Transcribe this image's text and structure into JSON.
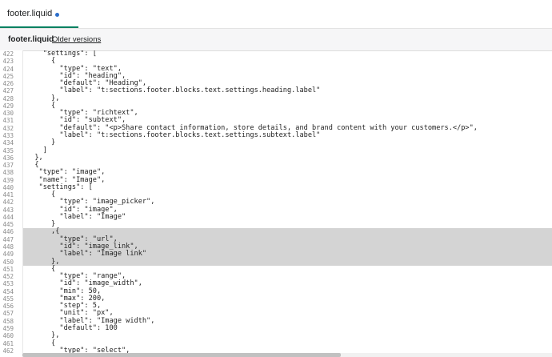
{
  "tab": {
    "label": "footer.liquid"
  },
  "file_header": {
    "name": "footer.liquid",
    "older_versions": "Older versions"
  },
  "editor": {
    "highlighted_lines": [
      446,
      447,
      448,
      449,
      450
    ],
    "lines": [
      {
        "n": "422",
        "text": "    \"settings\": ["
      },
      {
        "n": "423",
        "text": "      {"
      },
      {
        "n": "424",
        "text": "        \"type\": \"text\","
      },
      {
        "n": "425",
        "text": "        \"id\": \"heading\","
      },
      {
        "n": "426",
        "text": "        \"default\": \"Heading\","
      },
      {
        "n": "427",
        "text": "        \"label\": \"t:sections.footer.blocks.text.settings.heading.label\""
      },
      {
        "n": "428",
        "text": "      },"
      },
      {
        "n": "429",
        "text": "      {"
      },
      {
        "n": "430",
        "text": "        \"type\": \"richtext\","
      },
      {
        "n": "431",
        "text": "        \"id\": \"subtext\","
      },
      {
        "n": "432",
        "text": "        \"default\": \"<p>Share contact information, store details, and brand content with your customers.</p>\","
      },
      {
        "n": "433",
        "text": "        \"label\": \"t:sections.footer.blocks.text.settings.subtext.label\""
      },
      {
        "n": "434",
        "text": "      }"
      },
      {
        "n": "435",
        "text": "    ]"
      },
      {
        "n": "436",
        "text": "  },"
      },
      {
        "n": "437",
        "text": "  {"
      },
      {
        "n": "438",
        "text": "   \"type\": \"image\","
      },
      {
        "n": "439",
        "text": "   \"name\": \"Image\","
      },
      {
        "n": "440",
        "text": "   \"settings\": ["
      },
      {
        "n": "441",
        "text": "      {"
      },
      {
        "n": "442",
        "text": "        \"type\": \"image_picker\","
      },
      {
        "n": "443",
        "text": "        \"id\": \"image\","
      },
      {
        "n": "444",
        "text": "        \"label\": \"Image\""
      },
      {
        "n": "445",
        "text": "      }"
      },
      {
        "n": "446",
        "text": "      ,{"
      },
      {
        "n": "447",
        "text": "        \"type\": \"url\","
      },
      {
        "n": "448",
        "text": "        \"id\": \"image_link\","
      },
      {
        "n": "449",
        "text": "        \"label\": \"Image link\""
      },
      {
        "n": "450",
        "text": "      },"
      },
      {
        "n": "451",
        "text": "      {"
      },
      {
        "n": "452",
        "text": "        \"type\": \"range\","
      },
      {
        "n": "453",
        "text": "        \"id\": \"image_width\","
      },
      {
        "n": "454",
        "text": "        \"min\": 50,"
      },
      {
        "n": "455",
        "text": "        \"max\": 200,"
      },
      {
        "n": "456",
        "text": "        \"step\": 5,"
      },
      {
        "n": "457",
        "text": "        \"unit\": \"px\","
      },
      {
        "n": "458",
        "text": "        \"label\": \"Image width\","
      },
      {
        "n": "459",
        "text": "        \"default\": 100"
      },
      {
        "n": "460",
        "text": "      },"
      },
      {
        "n": "461",
        "text": "      {"
      },
      {
        "n": "462",
        "text": "        \"type\": \"select\","
      }
    ]
  }
}
